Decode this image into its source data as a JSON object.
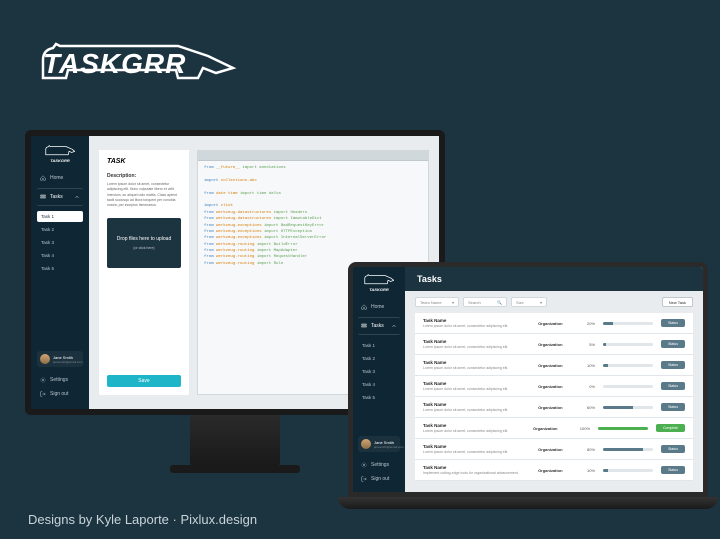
{
  "brand": {
    "name": "TASKGRR"
  },
  "desktop": {
    "sidebar": {
      "nav_home": "Home",
      "nav_tasks": "Tasks",
      "tasks": [
        {
          "label": "Task 1"
        },
        {
          "label": "Task 2"
        },
        {
          "label": "Task 3"
        },
        {
          "label": "Task 4"
        },
        {
          "label": "Task 5"
        }
      ],
      "user": {
        "name": "Jane Smith",
        "email": "janesmith@email.com"
      },
      "settings": "Settings",
      "signout": "Sign out"
    },
    "task_panel": {
      "title": "TASK",
      "description_label": "Description:",
      "description_text": "Lorem ipsum dolor sit amet, consectetur adipiscing elit. Nunc vulputate libero et velit interdum, ac aliquet odio mattis. Class aptent taciti sociosqu ad litora torquent per conubia nostra, per inceptos himenaeos.",
      "dropzone_label": "Drop files here to upload",
      "dropzone_sub": "(or click here)",
      "save_label": "Save"
    },
    "code": {
      "lines": [
        {
          "pre": "from ",
          "mod": "__future__",
          "post": " import annotations"
        },
        {
          "pre": "",
          "mod": "",
          "post": ""
        },
        {
          "pre": "import ",
          "mod": "collections.abc",
          "post": ""
        },
        {
          "pre": "",
          "mod": "",
          "post": ""
        },
        {
          "pre": "from ",
          "mod": "date time",
          "post": " import time delta"
        },
        {
          "pre": "",
          "mod": "",
          "post": ""
        },
        {
          "pre": "import ",
          "mod": "click",
          "post": ""
        },
        {
          "pre": "from ",
          "mod": "werkzeug.datastructures",
          "post": " import Headers"
        },
        {
          "pre": "from ",
          "mod": "werkzeug.datastructures",
          "post": " import ImmutableDict"
        },
        {
          "pre": "from ",
          "mod": "werkzeug.exceptions",
          "post": " import BadRequestKeyError"
        },
        {
          "pre": "from ",
          "mod": "werkzeug.exceptions",
          "post": " import HTTPException"
        },
        {
          "pre": "from ",
          "mod": "werkzeug.exceptions",
          "post": " import InternalServerError"
        },
        {
          "pre": "from ",
          "mod": "werkzeug.routing",
          "post": " import BuildError"
        },
        {
          "pre": "from ",
          "mod": "werkzeug.routing",
          "post": " import MapAdapter"
        },
        {
          "pre": "from ",
          "mod": "werkzeug.routing",
          "post": " import RequestHandler"
        },
        {
          "pre": "from ",
          "mod": "werkzeug.routing",
          "post": " import Rule"
        }
      ]
    }
  },
  "laptop": {
    "page_title": "Tasks",
    "sidebar": {
      "nav_home": "Home",
      "nav_tasks": "Tasks",
      "tasks": [
        {
          "label": "Task 1"
        },
        {
          "label": "Task 2"
        },
        {
          "label": "Task 3"
        },
        {
          "label": "Task 4"
        },
        {
          "label": "Task 5"
        }
      ],
      "user": {
        "name": "Jane Smith",
        "email": "janesmith@email.com"
      },
      "settings": "Settings",
      "signout": "Sign out"
    },
    "filters": {
      "team_name": "Team Name",
      "search": "Search",
      "size": "Size",
      "new_task": "New Task"
    },
    "rows": [
      {
        "name": "Task Name",
        "desc": "Lorem ipsum dolor sit amet, consectetur adipiscing elit.",
        "org": "Organization",
        "pct": 20,
        "status": "Status"
      },
      {
        "name": "Task Name",
        "desc": "Lorem ipsum dolor sit amet, consectetur adipiscing elit.",
        "org": "Organization",
        "pct": 5,
        "status": "Status"
      },
      {
        "name": "Task Name",
        "desc": "Lorem ipsum dolor sit amet, consectetur adipiscing elit.",
        "org": "Organization",
        "pct": 10,
        "status": "Status"
      },
      {
        "name": "Task Name",
        "desc": "Lorem ipsum dolor sit amet, consectetur adipiscing elit.",
        "org": "Organization",
        "pct": 0,
        "status": "Status"
      },
      {
        "name": "Task Name",
        "desc": "Lorem ipsum dolor sit amet, consectetur adipiscing elit.",
        "org": "Organization",
        "pct": 60,
        "status": "Status"
      },
      {
        "name": "Task Name",
        "desc": "Lorem ipsum dolor sit amet, consectetur adipiscing elit.",
        "org": "Organization",
        "pct": 100,
        "status": "Complete"
      },
      {
        "name": "Task Name",
        "desc": "Lorem ipsum dolor sit amet, consectetur adipiscing elit.",
        "org": "Organization",
        "pct": 80,
        "status": "Status"
      },
      {
        "name": "Task Name",
        "desc": "Implement cutting-edge tools for organizational advancement.",
        "org": "Organization",
        "pct": 10,
        "status": "Status"
      }
    ]
  },
  "credit": "Designs by Kyle Laporte · Pixlux.design"
}
